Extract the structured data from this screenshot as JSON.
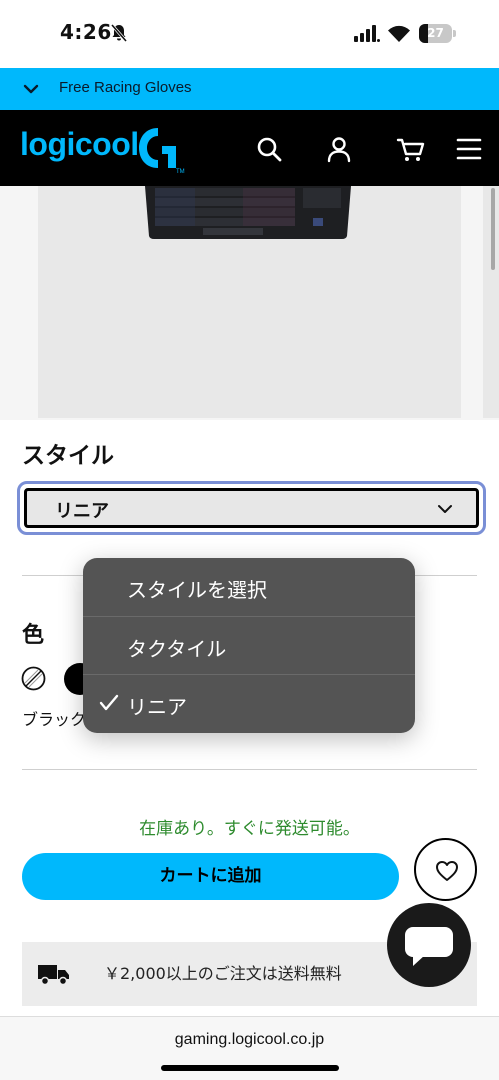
{
  "status_bar": {
    "time": "4:26",
    "battery_level": "27",
    "battery_fraction": 0.27,
    "icons": [
      "bell-muted-icon",
      "signal-icon",
      "wifi-icon",
      "battery-icon"
    ]
  },
  "promo": {
    "text": "Free Racing Gloves"
  },
  "header": {
    "logo_text": "logicool",
    "icons": [
      "search-icon",
      "account-icon",
      "cart-icon",
      "menu-icon"
    ]
  },
  "product": {
    "style_heading": "スタイル",
    "style_selected": "リニア",
    "color_heading": "色",
    "color_name": "ブラック",
    "stock_status": "在庫あり。すぐに発送可能。",
    "add_to_cart": "カートに追加",
    "shipping_text": "￥2,000以上のご注文は送料無料"
  },
  "dropdown": {
    "options": [
      {
        "label": "スタイルを選択",
        "selected": false
      },
      {
        "label": "タクタイル",
        "selected": false
      },
      {
        "label": "リニア",
        "selected": true
      }
    ]
  },
  "browser": {
    "url": "gaming.logicool.co.jp"
  },
  "colors": {
    "accent": "#00b8fc",
    "header_bg": "#000000",
    "stock_green": "#2e8b2e",
    "menu_bg": "#545454",
    "select_focus": "#7a8fd6"
  }
}
